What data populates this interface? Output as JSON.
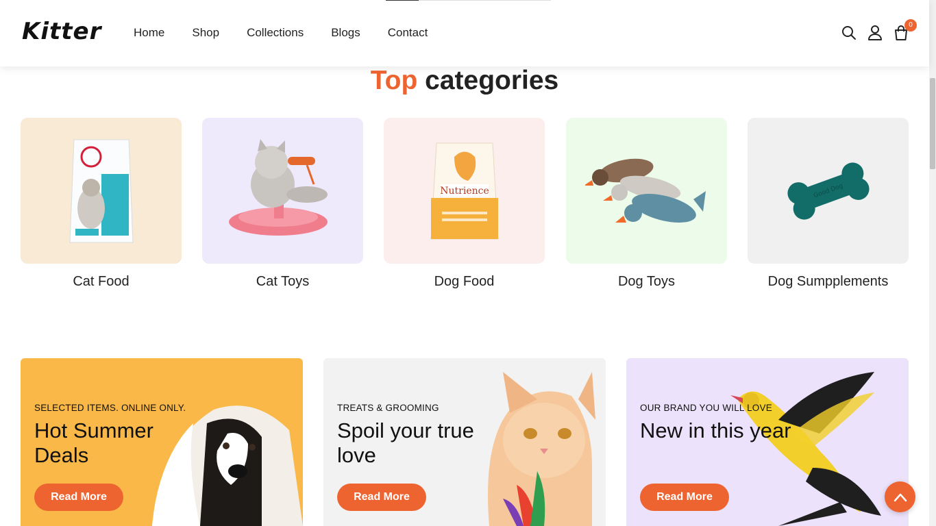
{
  "header": {
    "logo": "Kitter",
    "nav": [
      "Home",
      "Shop",
      "Collections",
      "Blogs",
      "Contact"
    ],
    "icons": [
      "search-icon",
      "user-icon",
      "cart-icon"
    ],
    "cart_count": "0"
  },
  "section": {
    "title_accent": "Top",
    "title_rest": "categories"
  },
  "categories": [
    {
      "label": "Cat Food",
      "bg": "#f8ead4"
    },
    {
      "label": "Cat Toys",
      "bg": "#eeeafc"
    },
    {
      "label": "Dog Food",
      "bg": "#fdeeee"
    },
    {
      "label": "Dog Toys",
      "bg": "#ecfbea"
    },
    {
      "label": "Dog Sumpplements",
      "bg": "#f0f0f0"
    }
  ],
  "banners": [
    {
      "kicker": "SELECTED ITEMS. ONLINE ONLY.",
      "title": "Hot Summer Deals",
      "button": "Read More",
      "bg": "#fab848"
    },
    {
      "kicker": "TREATS & GROOMING",
      "title": "Spoil your true love",
      "button": "Read More",
      "bg": "#f2f2f2"
    },
    {
      "kicker": "OUR BRAND YOU WILL LOVE",
      "title": "New in this year",
      "button": "Read More",
      "bg": "#ece2fb"
    }
  ],
  "colors": {
    "accent": "#ee6431"
  }
}
